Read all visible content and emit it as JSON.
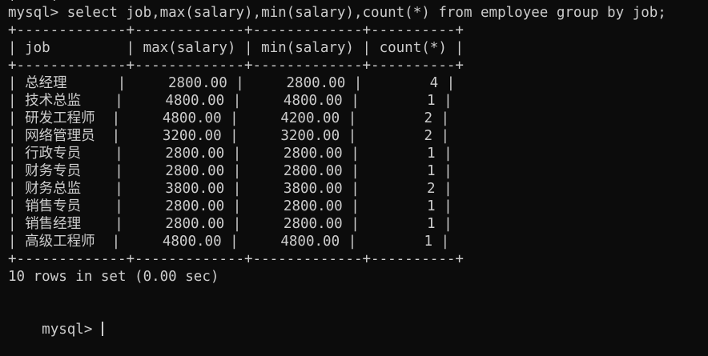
{
  "terminal": {
    "partial_line": "+----+",
    "command_line": "mysql> select job,max(salary),min(salary),count(*) from employee group by job;",
    "border_line": "+-------------+-------------+-------------+----------+",
    "header_row": "| job         | max(salary) | min(salary) | count(*) |",
    "rows": [
      "| 总经理      |     2800.00 |     2800.00 |        4 |",
      "| 技术总监    |     4800.00 |     4800.00 |        1 |",
      "| 研发工程师  |     4800.00 |     4200.00 |        2 |",
      "| 网络管理员  |     3200.00 |     3200.00 |        2 |",
      "| 行政专员    |     2800.00 |     2800.00 |        1 |",
      "| 财务专员    |     2800.00 |     2800.00 |        1 |",
      "| 财务总监    |     3800.00 |     3800.00 |        2 |",
      "| 销售专员    |     2800.00 |     2800.00 |        1 |",
      "| 销售经理    |     2800.00 |     2800.00 |        1 |",
      "| 高级工程师  |     4800.00 |     4800.00 |        1 |"
    ],
    "result_summary": "10 rows in set (0.00 sec)",
    "prompt": "mysql> "
  },
  "colors": {
    "background": "#0c0c0c",
    "foreground": "#cccccc"
  }
}
